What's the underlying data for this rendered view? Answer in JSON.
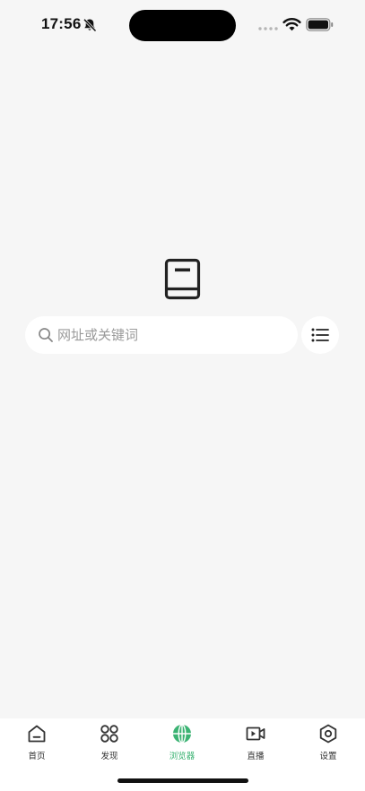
{
  "status_bar": {
    "time": "17:56",
    "icons": [
      "bell-slash-icon",
      "wifi-icon",
      "battery-icon"
    ]
  },
  "search": {
    "placeholder": "网址或关键词",
    "value": ""
  },
  "colors": {
    "accent": "#3bb373",
    "background": "#f6f6f6",
    "surface": "#ffffff",
    "text": "#333333",
    "placeholder": "#9a9a9a"
  },
  "tabbar": {
    "active": "browser",
    "tabs": [
      {
        "id": "home",
        "label": "首页",
        "icon": "home-icon"
      },
      {
        "id": "discover",
        "label": "发现",
        "icon": "grid-icon"
      },
      {
        "id": "browser",
        "label": "浏览器",
        "icon": "globe-icon"
      },
      {
        "id": "live",
        "label": "直播",
        "icon": "video-play-icon"
      },
      {
        "id": "settings",
        "label": "设置",
        "icon": "gear-hexagon-icon"
      }
    ]
  }
}
